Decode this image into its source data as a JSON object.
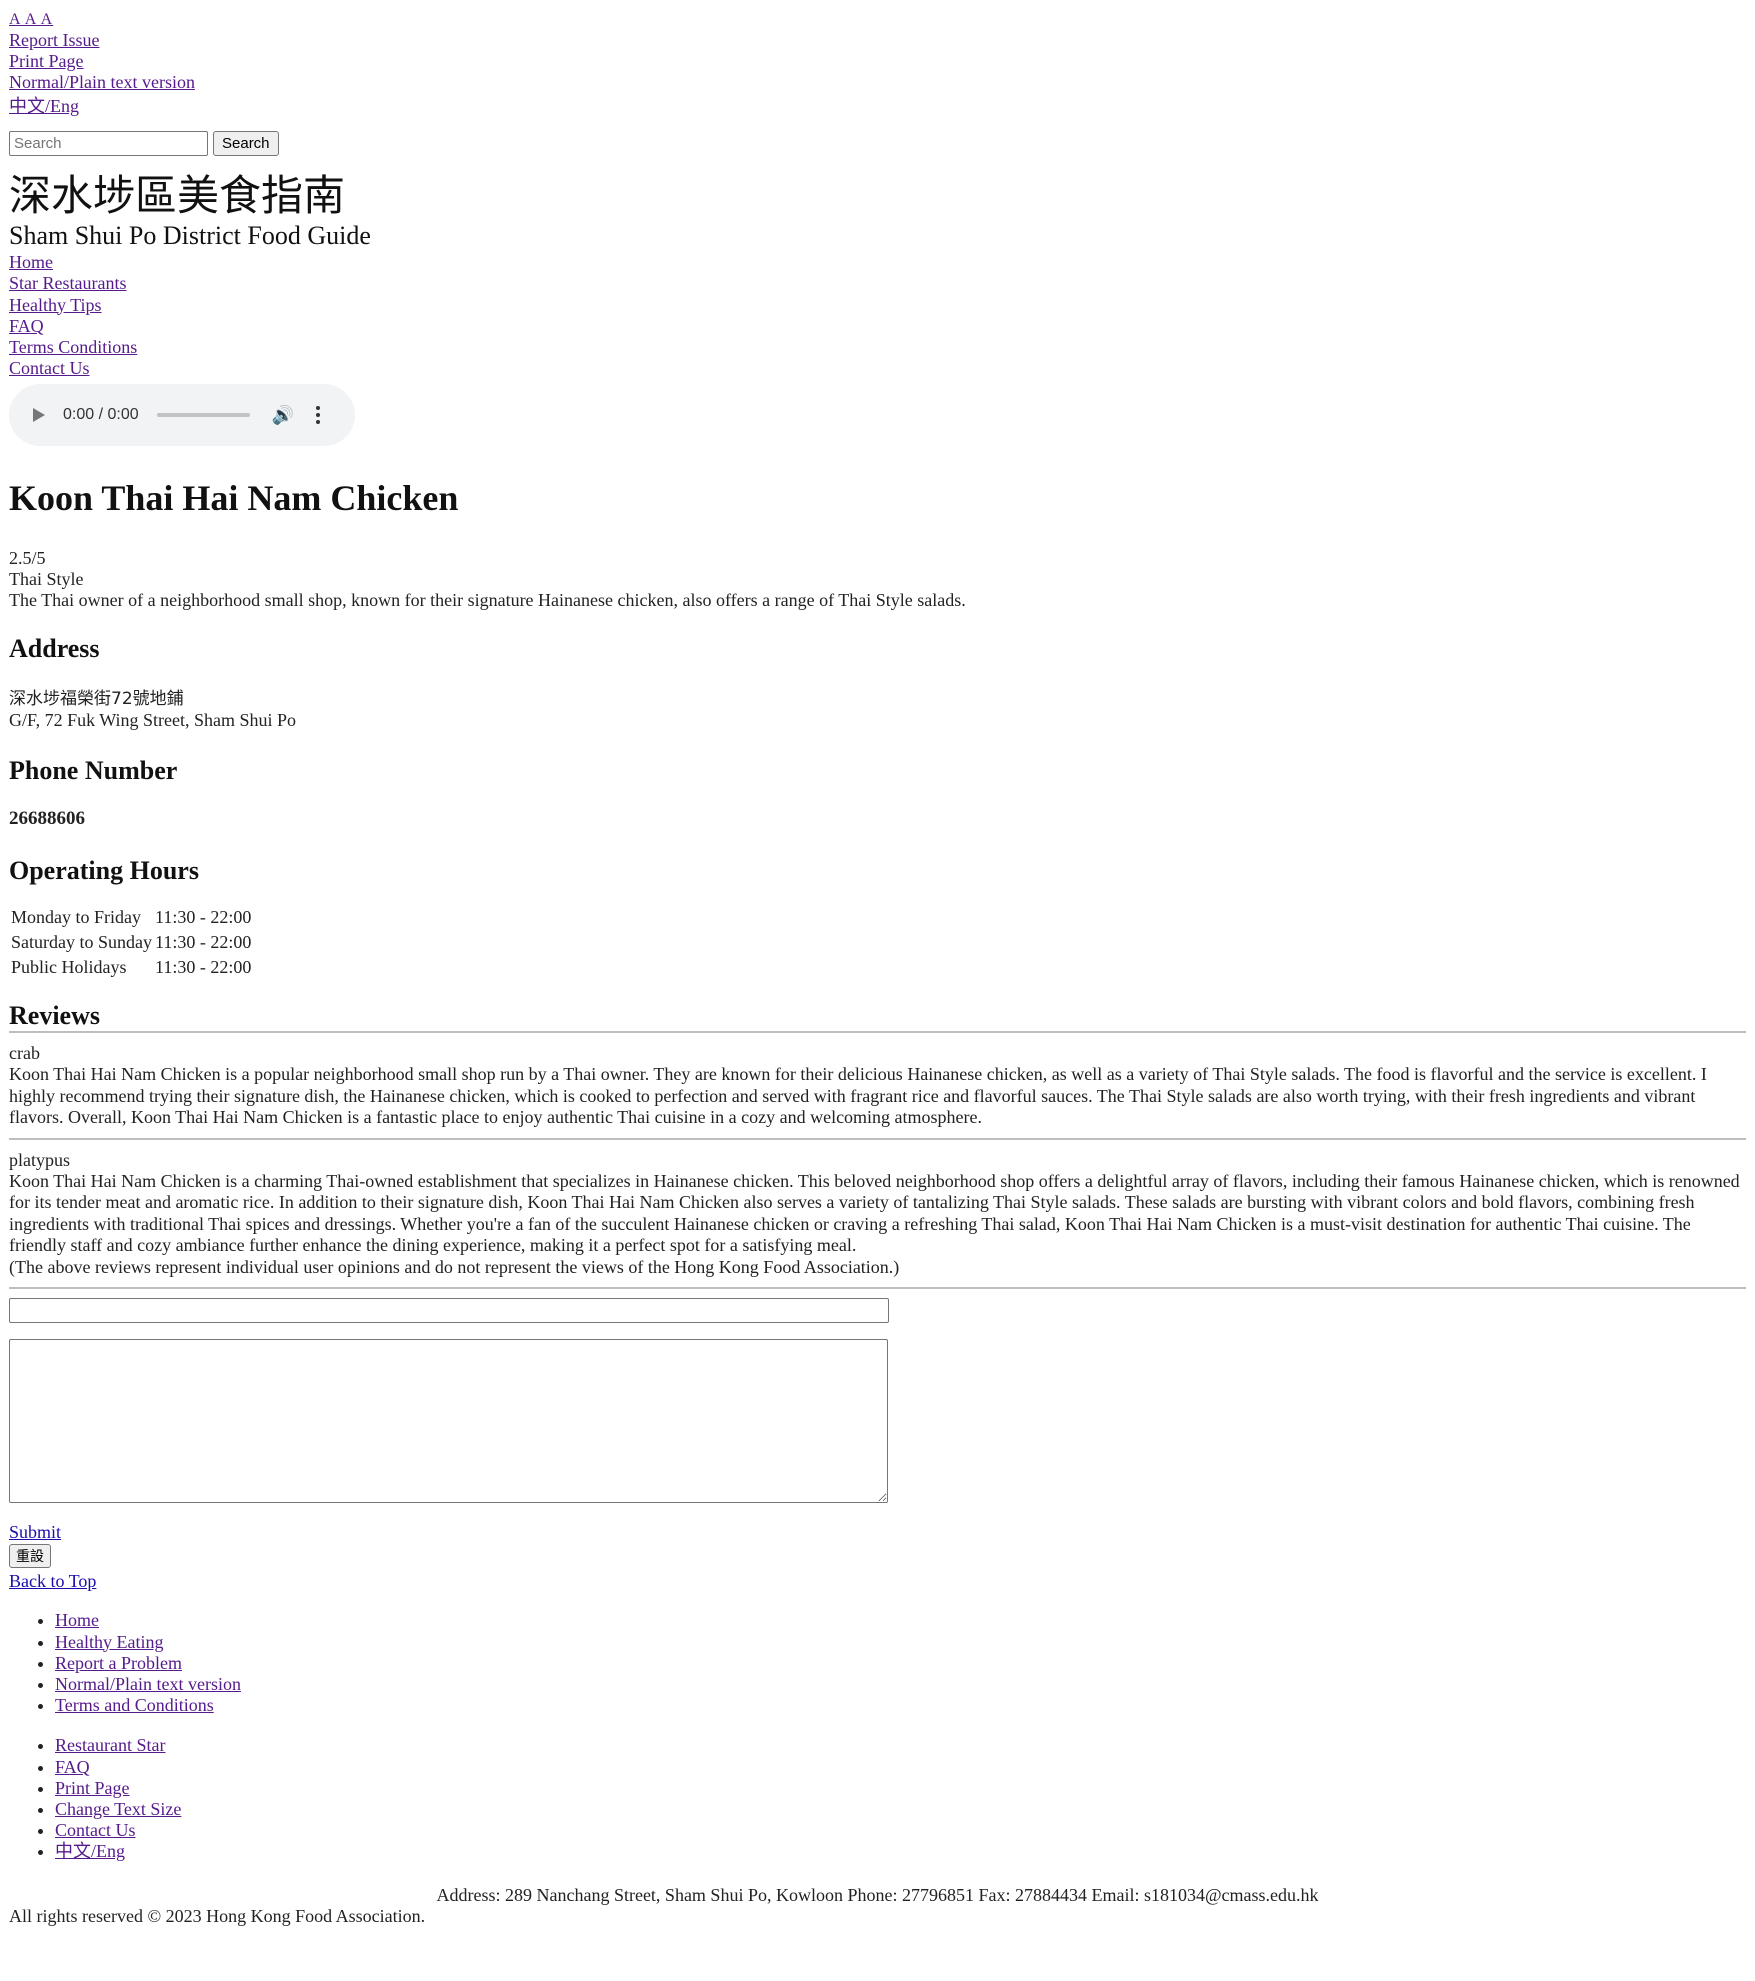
{
  "accessibility": {
    "text_size": "A A A",
    "report_issue": "Report Issue",
    "print_page": "Print Page",
    "plain_text": "Normal/Plain text version",
    "language": "中文/Eng"
  },
  "search": {
    "placeholder": "Search",
    "button": "Search"
  },
  "site": {
    "title_zh": "深水埗區美食指南",
    "title_en": "Sham Shui Po District Food Guide"
  },
  "nav": {
    "items": [
      "Home",
      "Star Restaurants",
      "Healthy Tips",
      "FAQ",
      "Terms Conditions",
      "Contact Us"
    ]
  },
  "audio": {
    "time": "0:00 / 0:00"
  },
  "restaurant": {
    "name": "Koon Thai Hai Nam Chicken",
    "rating": "2.5/5",
    "style": "Thai Style",
    "description": "The Thai owner of a neighborhood small shop, known for their signature Hainanese chicken, also offers a range of Thai Style salads."
  },
  "address": {
    "heading": "Address",
    "zh": "深水埗福榮街72號地鋪",
    "en": "G/F, 72 Fuk Wing Street, Sham Shui Po"
  },
  "phone": {
    "heading": "Phone Number",
    "number": "26688606"
  },
  "hours": {
    "heading": "Operating Hours",
    "rows": [
      {
        "day": "Monday to Friday",
        "time": "11:30 - 22:00"
      },
      {
        "day": "Saturday to Sunday",
        "time": "11:30 - 22:00"
      },
      {
        "day": "Public Holidays",
        "time": "11:30 - 22:00"
      }
    ]
  },
  "reviews": {
    "heading": "Reviews",
    "items": [
      {
        "user": "crab",
        "text": "Koon Thai Hai Nam Chicken is a popular neighborhood small shop run by a Thai owner. They are known for their delicious Hainanese chicken, as well as a variety of Thai Style salads. The food is flavorful and the service is excellent. I highly recommend trying their signature dish, the Hainanese chicken, which is cooked to perfection and served with fragrant rice and flavorful sauces. The Thai Style salads are also worth trying, with their fresh ingredients and vibrant flavors. Overall, Koon Thai Hai Nam Chicken is a fantastic place to enjoy authentic Thai cuisine in a cozy and welcoming atmosphere."
      },
      {
        "user": "platypus",
        "text": "Koon Thai Hai Nam Chicken is a charming Thai-owned establishment that specializes in Hainanese chicken. This beloved neighborhood shop offers a delightful array of flavors, including their famous Hainanese chicken, which is renowned for its tender meat and aromatic rice. In addition to their signature dish, Koon Thai Hai Nam Chicken also serves a variety of tantalizing Thai Style salads. These salads are bursting with vibrant colors and bold flavors, combining fresh ingredients with traditional Thai spices and dressings. Whether you're a fan of the succulent Hainanese chicken or craving a refreshing Thai salad, Koon Thai Hai Nam Chicken is a must-visit destination for authentic Thai cuisine. The friendly staff and cozy ambiance further enhance the dining experience, making it a perfect spot for a satisfying meal."
      }
    ],
    "disclaimer": "(The above reviews represent individual user opinions and do not represent the views of the Hong Kong Food Association.)"
  },
  "form": {
    "submit": "Submit",
    "reset": "重設",
    "back_to_top": "Back to Top"
  },
  "footer": {
    "nav1": [
      "Home",
      "Healthy Eating",
      "Report a Problem",
      "Normal/Plain text version",
      "Terms and Conditions"
    ],
    "nav2": [
      "Restaurant Star",
      "FAQ",
      "Print Page",
      "Change Text Size",
      "Contact Us",
      "中文/Eng"
    ],
    "contact": "Address: 289 Nanchang Street, Sham Shui Po, Kowloon Phone: 27796851 Fax: 27884434 Email: s181034@cmass.edu.hk",
    "copyright": "All rights reserved © 2023 Hong Kong Food Association."
  }
}
